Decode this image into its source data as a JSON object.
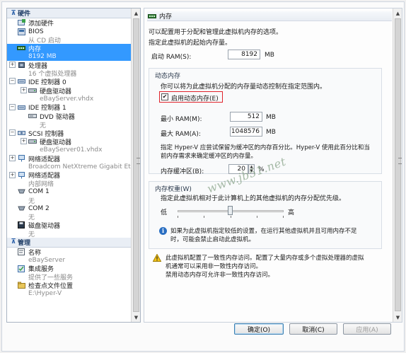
{
  "sidebar": {
    "hardware_header": "硬件",
    "management_header": "管理",
    "items": [
      {
        "label": "添加硬件",
        "sub": ""
      },
      {
        "label": "BIOS",
        "sub": "从 CD 启动"
      },
      {
        "label": "内存",
        "sub": "8192 MB"
      },
      {
        "label": "处理器",
        "sub": "16 个虚拟处理器"
      },
      {
        "label": "IDE 控制器 0",
        "sub": ""
      },
      {
        "label": "硬盘驱动器",
        "sub": "eBayServer.vhdx"
      },
      {
        "label": "IDE 控制器 1",
        "sub": ""
      },
      {
        "label": "DVD 驱动器",
        "sub": "无"
      },
      {
        "label": "SCSI 控制器",
        "sub": ""
      },
      {
        "label": "硬盘驱动器",
        "sub": "eBayServer01.vhdx"
      },
      {
        "label": "网络适配器",
        "sub": "Broadcom NetXtreme Gigabit Et..."
      },
      {
        "label": "网络适配器",
        "sub": "内部网络"
      },
      {
        "label": "COM 1",
        "sub": "无"
      },
      {
        "label": "COM 2",
        "sub": "无"
      },
      {
        "label": "磁盘驱动器",
        "sub": "无"
      }
    ],
    "management": [
      {
        "label": "名称",
        "sub": "eBayServer"
      },
      {
        "label": "集成服务",
        "sub": "提供了一些服务"
      },
      {
        "label": "检查点文件位置",
        "sub": "E:\\Hyper-V"
      }
    ]
  },
  "memory": {
    "title": "内存",
    "desc1": "可以配置用于分配和管理此虚拟机内存的选项。",
    "desc2": "指定此虚拟机的起始内存量。",
    "startup_label": "启动 RAM(S):",
    "startup_value": "8192",
    "unit": "MB",
    "dynamic_title": "动态内存",
    "dynamic_desc": "你可以将为此虚拟机分配的内存量动态控制在指定范围内。",
    "enable_dynamic": "启用动态内存(E)",
    "enable_checked": true,
    "min_label": "最小 RAM(M):",
    "min_value": "512",
    "max_label": "最大 RAM(A):",
    "max_value": "1048576",
    "buffer_desc1": "指定 Hyper-V 应尝试保留为缓冲区的内存百分比。Hyper-V 使用此百分比和当",
    "buffer_desc2": "前内存需求来确定缓冲区的内存量。",
    "buffer_label": "内存缓冲区(B):",
    "buffer_value": "20",
    "percent": "%",
    "weight_title": "内存权重(W)",
    "weight_desc": "指定此虚拟机相对于此计算机上的其他虚拟机的内存分配优先级。",
    "low": "低",
    "high": "高",
    "weight_level": 0.5,
    "weight_info1": "如果为此虚拟机指定较低的设置，在运行其他虚拟机并且可用内存不足",
    "weight_info2": "时，可能会禁止启动此虚拟机。",
    "warning1": "此虚拟机配置了一致性内存访问。配置了大量内存或多个虚拟处理器的虚拟",
    "warning2": "机通常可以采用非一致性内存访问。",
    "warning3": "禁用动态内存可允许非一致性内存访问。"
  },
  "watermark": "www.jb51.net",
  "buttons": {
    "ok": "确定(O)",
    "cancel": "取消(C)",
    "apply": "应用(A)"
  }
}
